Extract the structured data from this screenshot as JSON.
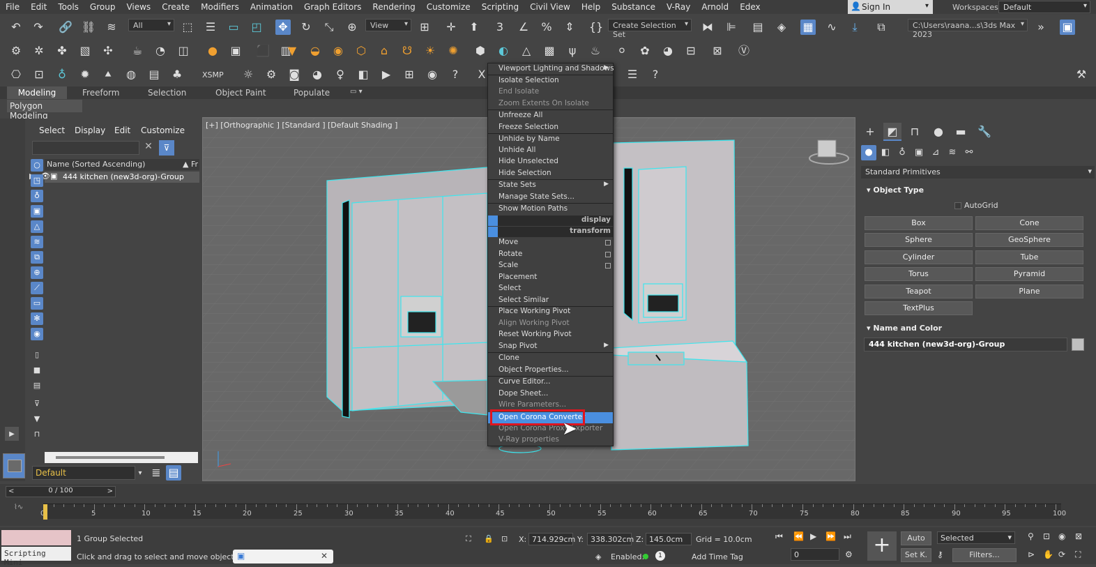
{
  "menus": [
    "File",
    "Edit",
    "Tools",
    "Group",
    "Views",
    "Create",
    "Modifiers",
    "Animation",
    "Graph Editors",
    "Rendering",
    "Customize",
    "Scripting",
    "Civil View",
    "Help",
    "Substance",
    "V-Ray",
    "Arnold",
    "Edex"
  ],
  "signin": {
    "label": "Sign In"
  },
  "workspaces": {
    "label": "Workspaces:",
    "value": "Default"
  },
  "toolbar": {
    "filter": "All",
    "refcoord": "View",
    "selection_set": "Create Selection Set",
    "path": "C:\\Users\\raana...s\\3ds Max 2023",
    "xsmp": "XSMP"
  },
  "ribbon": {
    "tabs": [
      "Modeling",
      "Freeform",
      "Selection",
      "Object Paint",
      "Populate"
    ],
    "sub": "Polygon Modeling"
  },
  "scene_explorer": {
    "menus": [
      "Select",
      "Display",
      "Edit",
      "Customize"
    ],
    "column_header": "Name (Sorted Ascending)",
    "column_header2": "Fr",
    "row": "444 kitchen (new3d-org)-Group",
    "layer": "Default"
  },
  "viewport": {
    "label": "[+] [Orthographic ] [Standard ] [Default Shading ]"
  },
  "context_menu": {
    "items": [
      {
        "label": "Viewport Lighting and Shadows",
        "state": "normal",
        "submenu": true
      },
      {
        "label": "Isolate Selection",
        "state": "normal"
      },
      {
        "label": "End Isolate",
        "state": "disabled"
      },
      {
        "label": "Zoom Extents On Isolate",
        "state": "disabled"
      },
      {
        "label": "Unfreeze All",
        "state": "normal"
      },
      {
        "label": "Freeze Selection",
        "state": "normal"
      },
      {
        "label": "Unhide by Name",
        "state": "normal"
      },
      {
        "label": "Unhide All",
        "state": "normal"
      },
      {
        "label": "Hide Unselected",
        "state": "normal"
      },
      {
        "label": "Hide Selection",
        "state": "normal"
      },
      {
        "label": "State Sets",
        "state": "normal",
        "submenu": true
      },
      {
        "label": "Manage State Sets...",
        "state": "normal"
      },
      {
        "label": "Show Motion Paths",
        "state": "normal"
      },
      {
        "label": "Move",
        "state": "normal"
      },
      {
        "label": "Rotate",
        "state": "normal"
      },
      {
        "label": "Scale",
        "state": "normal"
      },
      {
        "label": "Placement",
        "state": "normal"
      },
      {
        "label": "Select",
        "state": "normal"
      },
      {
        "label": "Select Similar",
        "state": "normal"
      },
      {
        "label": "Place Working Pivot",
        "state": "normal"
      },
      {
        "label": "Align Working Pivot",
        "state": "disabled"
      },
      {
        "label": "Reset Working Pivot",
        "state": "normal"
      },
      {
        "label": "Snap Pivot",
        "state": "normal",
        "submenu": true
      },
      {
        "label": "Clone",
        "state": "normal"
      },
      {
        "label": "Object Properties...",
        "state": "normal"
      },
      {
        "label": "Curve Editor...",
        "state": "normal"
      },
      {
        "label": "Dope Sheet...",
        "state": "normal"
      },
      {
        "label": "Wire Parameters...",
        "state": "disabled"
      },
      {
        "label": "Open Corona Converter",
        "state": "highlighted"
      },
      {
        "label": "Open Corona Proxy Exporter",
        "state": "disabled"
      },
      {
        "label": "V-Ray properties",
        "state": "disabled"
      }
    ],
    "sections": {
      "display": "display",
      "transform": "transform"
    }
  },
  "command_panel": {
    "category": "Standard Primitives",
    "object_type": "Object Type",
    "autogrid": "AutoGrid",
    "primitives": [
      "Box",
      "Cone",
      "Sphere",
      "GeoSphere",
      "Cylinder",
      "Tube",
      "Torus",
      "Pyramid",
      "Teapot",
      "Plane",
      "TextPlus"
    ],
    "name_and_color": "Name and Color",
    "object_name": "444 kitchen (new3d-org)-Group"
  },
  "timeline": {
    "frame": "0 / 100",
    "ticks": [
      "0",
      "5",
      "10",
      "15",
      "20",
      "25",
      "30",
      "35",
      "40",
      "45",
      "50",
      "55",
      "60",
      "65",
      "70",
      "75",
      "80",
      "85",
      "90",
      "95",
      "100"
    ]
  },
  "status": {
    "maxscript": "Scripting Mini",
    "selected": "1 Group Selected",
    "prompt": "Click and drag to select and move objects",
    "x_label": "X:",
    "x": "714.929cm",
    "y_label": "Y:",
    "y": "338.302cm",
    "z_label": "Z:",
    "z": "145.0cm",
    "grid": "Grid = 10.0cm",
    "enabled": "Enabled:",
    "add_time_tag": "Add Time Tag",
    "auto": "Auto",
    "set_key": "Set K.",
    "selected_dd": "Selected",
    "filters": "Filters...",
    "frame_field": "0"
  }
}
